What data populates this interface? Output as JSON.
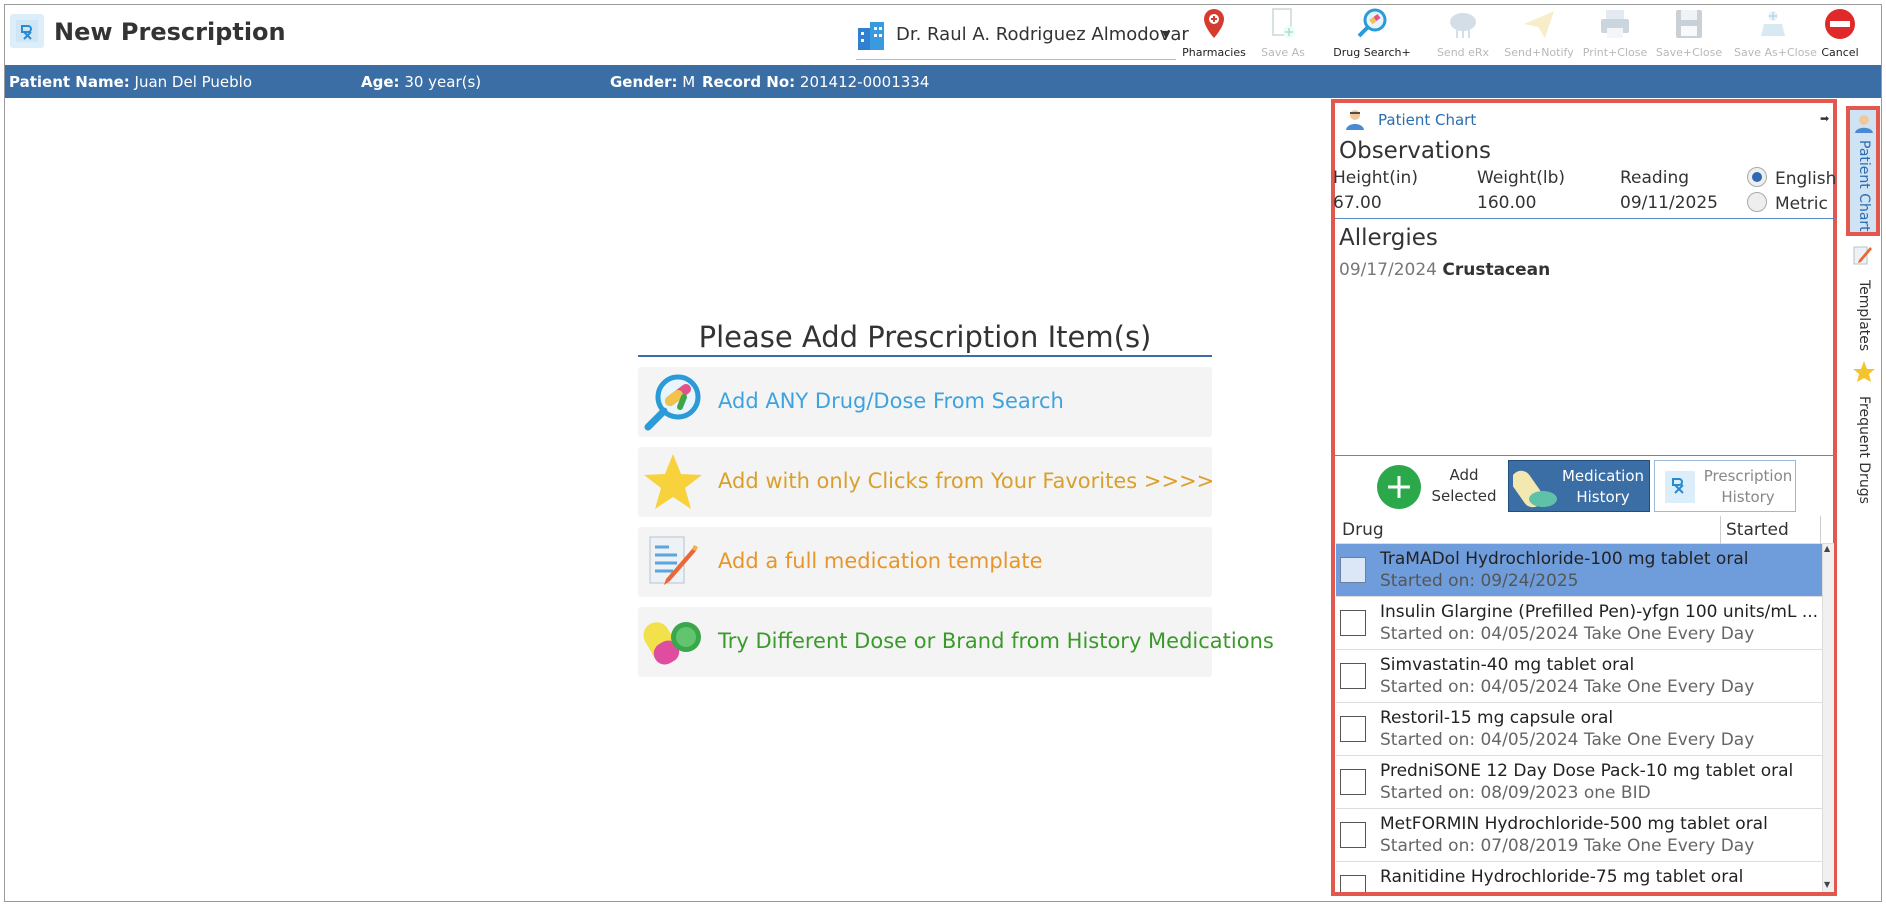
{
  "window": {
    "title": "New Prescription"
  },
  "doctor": {
    "name": "Dr. Raul A. Rodriguez Almodovar"
  },
  "toolbar": [
    {
      "label": "Pharmacies",
      "icon": "map-pin-icon",
      "enabled": true
    },
    {
      "label": "Save As",
      "icon": "save-as-icon",
      "enabled": false
    },
    {
      "label": "Drug Search+",
      "icon": "drug-search-icon",
      "enabled": true
    },
    {
      "label": "Send eRx",
      "icon": "cloud-icon",
      "enabled": false
    },
    {
      "label": "Send+Notify",
      "icon": "paper-plane-icon",
      "enabled": false
    },
    {
      "label": "Print+Close",
      "icon": "printer-icon",
      "enabled": false
    },
    {
      "label": "Save+Close",
      "icon": "floppy-icon",
      "enabled": false
    },
    {
      "label": "Save As+Close",
      "icon": "save-as-close-icon",
      "enabled": false
    },
    {
      "label": "Cancel",
      "icon": "cancel-icon",
      "enabled": true
    }
  ],
  "patient": {
    "name_label": "Patient Name:",
    "name": "Juan Del Pueblo",
    "age_label": "Age:",
    "age": "30 year(s)",
    "gender_label": "Gender:",
    "gender": "M",
    "record_label": "Record No:",
    "record": "201412-0001334"
  },
  "center": {
    "title": "Please Add Prescription Item(s)",
    "options": [
      {
        "label": "Add ANY Drug/Dose From Search",
        "icon": "magnifier-pill-icon",
        "color": "#3da3e0"
      },
      {
        "label": "Add with only Clicks from Your Favorites >>>>",
        "icon": "star-icon",
        "color": "#d9a02b"
      },
      {
        "label": "Add a full medication template",
        "icon": "document-pencil-icon",
        "color": "#e8952a"
      },
      {
        "label": "Try Different Dose or Brand from History Medications",
        "icon": "pills-icon",
        "color": "#3a9a2a"
      }
    ]
  },
  "chart": {
    "header": "Patient Chart",
    "observations": {
      "title": "Observations",
      "height_label": "Height(in)",
      "height": "67.00",
      "weight_label": "Weight(lb)",
      "weight": "160.00",
      "reading_label": "Reading",
      "reading": "09/11/2025",
      "units": [
        {
          "label": "English",
          "selected": true
        },
        {
          "label": "Metric",
          "selected": false
        }
      ]
    },
    "allergies": {
      "title": "Allergies",
      "items": [
        {
          "date": "09/17/2024",
          "name": "Crustacean"
        }
      ]
    },
    "buttons": {
      "add_selected": [
        "Add",
        "Selected"
      ],
      "medication_history": [
        "Medication",
        "History"
      ],
      "prescription_history": [
        "Prescription",
        "History"
      ]
    },
    "grid": {
      "columns": [
        "Drug",
        "Started"
      ],
      "rows": [
        {
          "drug": "TraMADol Hydrochloride-100 mg tablet oral",
          "detail": "Started on: 09/24/2025",
          "selected": true
        },
        {
          "drug": "Insulin Glargine (Prefilled Pen)-yfgn 100 units/mL ...",
          "detail": "Started on: 04/05/2024 Take One Every Day",
          "selected": false
        },
        {
          "drug": "Simvastatin-40 mg tablet oral",
          "detail": "Started on: 04/05/2024 Take One Every Day",
          "selected": false
        },
        {
          "drug": "Restoril-15 mg capsule oral",
          "detail": "Started on: 04/05/2024 Take One Every Day",
          "selected": false
        },
        {
          "drug": "PredniSONE 12 Day Dose Pack-10 mg tablet oral",
          "detail": "Started on: 08/09/2023 one BID",
          "selected": false
        },
        {
          "drug": "MetFORMIN Hydrochloride-500 mg tablet oral",
          "detail": "Started on: 07/08/2019 Take One Every Day",
          "selected": false
        },
        {
          "drug": "Ranitidine Hydrochloride-75 mg tablet oral",
          "detail": "",
          "selected": false
        }
      ]
    }
  },
  "rail": [
    {
      "label": "Patient Chart",
      "icon": "patient-chart-icon",
      "active": true
    },
    {
      "label": "Templates",
      "icon": "pencil-icon",
      "active": false
    },
    {
      "label": "Frequent Drugs",
      "icon": "star-icon",
      "active": false
    }
  ],
  "colors": {
    "accent": "#3a6ea5",
    "highlight": "#e2584f",
    "selected_row": "#6f9ddc"
  }
}
